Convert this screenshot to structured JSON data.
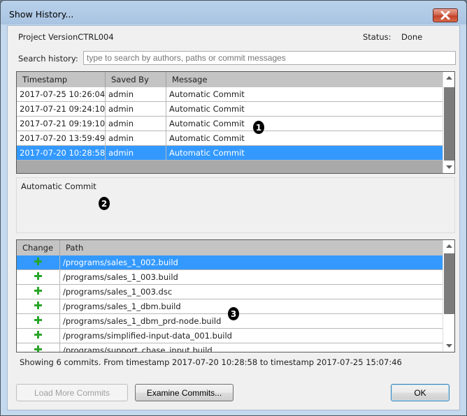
{
  "window": {
    "title": "Show History...",
    "close_icon": "close-icon"
  },
  "project": {
    "label": "Project VersionCTRL004",
    "status_label": "Status:",
    "status_value": "Done"
  },
  "search": {
    "label": "Search history:",
    "value": "",
    "placeholder": "type to search by authors, paths or commit messages"
  },
  "commits_table": {
    "columns": [
      "Timestamp",
      "Saved By",
      "Message"
    ],
    "rows": [
      {
        "timestamp": "2017-07-25 10:26:04",
        "saved_by": "admin",
        "message": "Automatic Commit",
        "selected": false
      },
      {
        "timestamp": "2017-07-21 09:24:10",
        "saved_by": "admin",
        "message": "Automatic Commit",
        "selected": false
      },
      {
        "timestamp": "2017-07-21 09:19:10",
        "saved_by": "admin",
        "message": "Automatic Commit",
        "selected": false
      },
      {
        "timestamp": "2017-07-20 13:59:49",
        "saved_by": "admin",
        "message": "Automatic Commit",
        "selected": false
      },
      {
        "timestamp": "2017-07-20 10:28:58",
        "saved_by": "admin",
        "message": "Automatic Commit",
        "selected": true
      }
    ]
  },
  "commit_detail": {
    "message": "Automatic Commit"
  },
  "changes_table": {
    "columns": [
      "Change",
      "Path"
    ],
    "rows": [
      {
        "change": "added",
        "path": "/programs/sales_1_002.build",
        "selected": true
      },
      {
        "change": "added",
        "path": "/programs/sales_1_003.build",
        "selected": false
      },
      {
        "change": "added",
        "path": "/programs/sales_1_003.dsc",
        "selected": false
      },
      {
        "change": "added",
        "path": "/programs/sales_1_dbm.build",
        "selected": false
      },
      {
        "change": "added",
        "path": "/programs/sales_1_dbm_prd-node.build",
        "selected": false
      },
      {
        "change": "added",
        "path": "/programs/simplified-input-data_001.build",
        "selected": false
      },
      {
        "change": "added",
        "path": "/programs/support_chase_input.build",
        "selected": false
      }
    ]
  },
  "annotations": [
    "1",
    "2",
    "3"
  ],
  "summary": "Showing 6 commits. From timestamp 2017-07-20 10:28:58  to timestamp  2017-07-25 15:07:46",
  "buttons": {
    "load_more": "Load More Commits",
    "examine": "Examine Commits...",
    "ok": "OK"
  },
  "colors": {
    "selection": "#3399ff",
    "added_icon": "#2aa52a",
    "close_button": "#c3422a"
  }
}
